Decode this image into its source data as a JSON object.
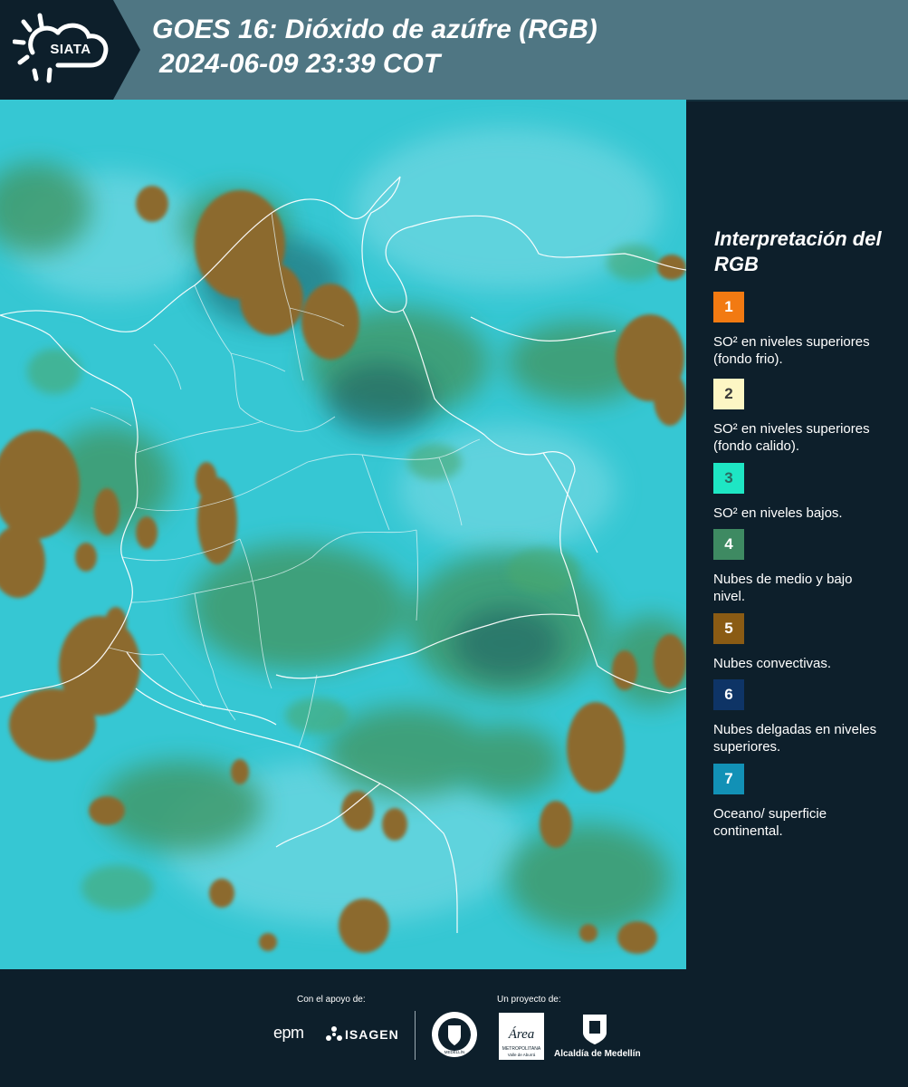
{
  "header": {
    "logo_text": "SIATA",
    "title_line1": "GOES 16: Dióxido de azúfre (RGB)",
    "title_line2": "2024-06-09 23:39 COT"
  },
  "legend": {
    "title": "Interpretación del RGB",
    "items": [
      {
        "number": "1",
        "label": "SO² en niveles superiores (fondo frio).",
        "color": "#f27a12"
      },
      {
        "number": "2",
        "label": "SO² en niveles superiores (fondo calido).",
        "color": "#fdf6c4"
      },
      {
        "number": "3",
        "label": "SO² en niveles bajos.",
        "color": "#1ee6c4"
      },
      {
        "number": "4",
        "label": "Nubes de medio y bajo nivel.",
        "color": "#3e8a62"
      },
      {
        "number": "5",
        "label": "Nubes convectivas.",
        "color": "#8a5b14"
      },
      {
        "number": "6",
        "label": "Nubes delgadas en niveles superiores.",
        "color": "#0e3466"
      },
      {
        "number": "7",
        "label": "Oceano/ superficie continental.",
        "color": "#1291b6"
      }
    ]
  },
  "footer": {
    "support_label": "Con el apoyo de:",
    "project_label": "Un proyecto de:",
    "sponsor_epm": "epm",
    "sponsor_isagen": "ISAGEN",
    "logo_medellin_ring": "MEDELLÍN",
    "logo_area_script": "Área",
    "logo_area_line1": "METROPOLITANA",
    "logo_area_line2": "Valle de Aburrá",
    "logo_alcaldia": "Alcaldía de Medellín"
  },
  "colors": {
    "background": "#0d1f2b",
    "header": "#4f7683",
    "map_base": "#33c9d6",
    "cloud_low": "#3e9a6a",
    "cloud_convective": "#8a6a2c"
  }
}
